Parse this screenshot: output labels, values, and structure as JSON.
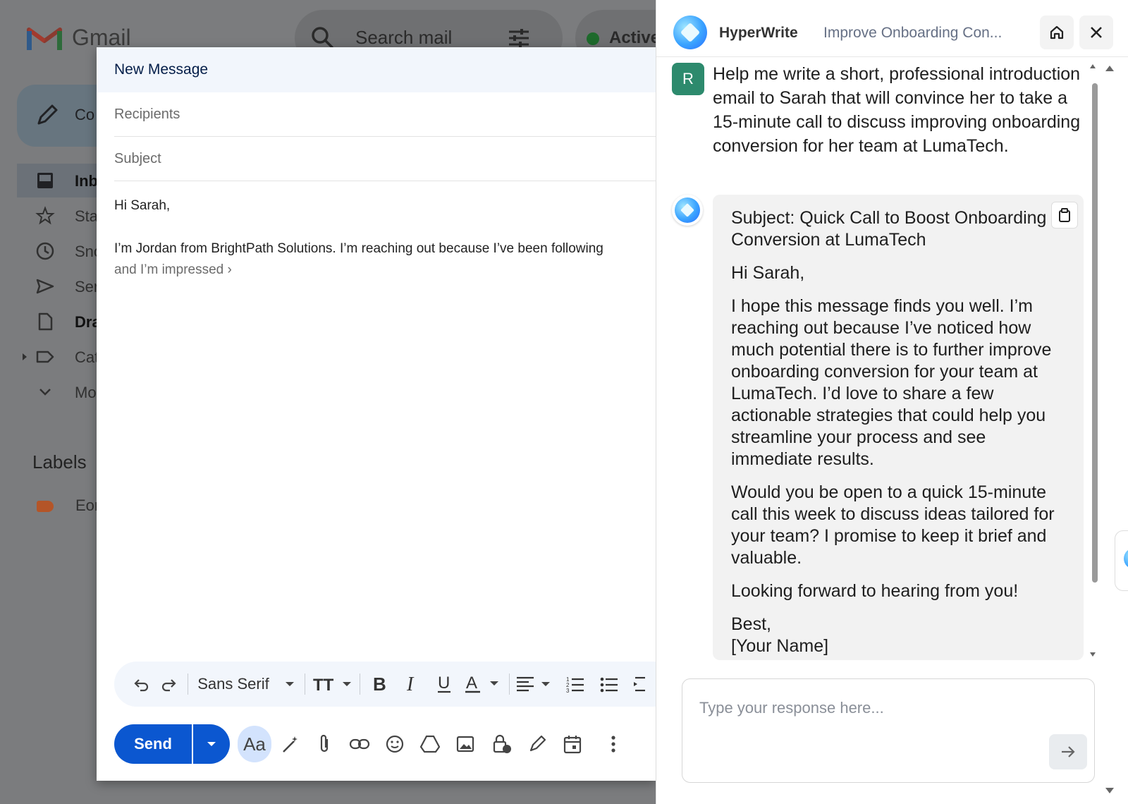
{
  "gmail": {
    "logo_text": "Gmail",
    "search_placeholder": "Search mail",
    "status": "Active",
    "compose_label": "Co",
    "nav": [
      {
        "label": "Inb",
        "icon": "inbox-icon"
      },
      {
        "label": "Sta",
        "icon": "star-icon"
      },
      {
        "label": "Sno",
        "icon": "clock-icon"
      },
      {
        "label": "Ser",
        "icon": "send-icon"
      },
      {
        "label": "Dra",
        "icon": "draft-icon"
      },
      {
        "label": "Cat",
        "icon": "label-icon"
      },
      {
        "label": "Mo",
        "icon": "chevron-down-icon"
      }
    ],
    "labels_heading": "Labels",
    "label_item": "Eor"
  },
  "compose": {
    "title": "New Message",
    "recipients_placeholder": "Recipients",
    "subject_placeholder": "Subject",
    "body_greeting": "Hi Sarah,",
    "body_line": "I’m Jordan from BrightPath Solutions. I’m reaching out because I’ve been following",
    "body_more": "and I’m impressed ›",
    "font_name": "Sans Serif",
    "send_label": "Send",
    "format_label": "Aa"
  },
  "hyperwrite": {
    "brand": "HyperWrite",
    "doc_title": "Improve Onboarding Con...",
    "user_initial": "R",
    "user_message": "Help me write a short, professional introduction email to Sarah that will convince her to take a 15-minute call to discuss improving onboarding conversion for her team at LumaTech.",
    "reply": {
      "subject": "Subject: Quick Call to Boost Onboarding Conversion at LumaTech",
      "greeting": "Hi Sarah,",
      "para1": "I hope this message finds you well. I’m reaching out because I’ve noticed how much potential there is to further improve onboarding conversion for your team at LumaTech. I’d love to share a few actionable strategies that could help you streamline your process and see immediate results.",
      "para2": "Would you be open to a quick 15-minute call this week to discuss ideas tailored for your team? I promise to keep it brief and valuable.",
      "para3": "Looking forward to hearing from you!",
      "signoff": "Best,",
      "name": "[Your Name]"
    },
    "input_placeholder": "Type your response here..."
  }
}
